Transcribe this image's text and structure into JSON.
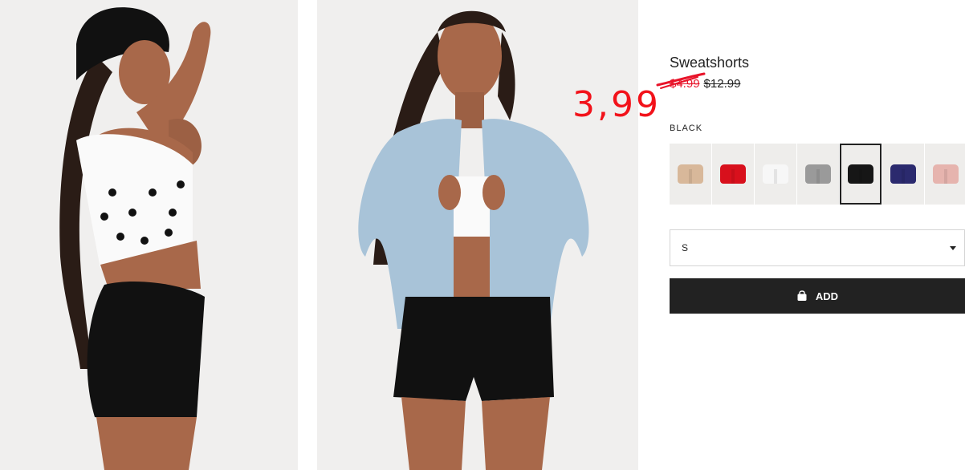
{
  "product": {
    "name": "Sweatshorts",
    "sale_price": "$4.99",
    "original_price": "$12.99",
    "annotation_price": "3,99",
    "selected_color": "BLACK",
    "swatches": [
      {
        "name": "beige",
        "color": "#d8b89a"
      },
      {
        "name": "red",
        "color": "#d8101c"
      },
      {
        "name": "white",
        "color": "#f7f7f7"
      },
      {
        "name": "grey",
        "color": "#9a9a9a"
      },
      {
        "name": "black",
        "color": "#161616",
        "selected": true
      },
      {
        "name": "navy",
        "color": "#2b2a6e"
      },
      {
        "name": "light-pink",
        "color": "#e6b4ae"
      }
    ],
    "size": "S",
    "add_label": "ADD"
  },
  "colors": {
    "sale": "#e8142a",
    "annotation": "#f2121a",
    "button": "#222222"
  }
}
